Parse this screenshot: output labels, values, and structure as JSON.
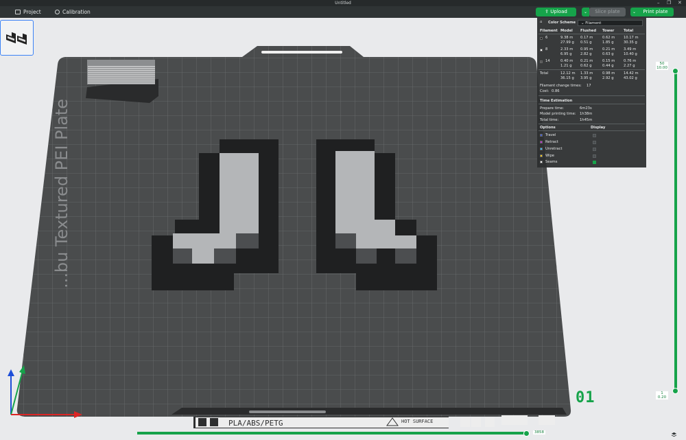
{
  "window": {
    "title": "Untitled"
  },
  "toolbar": {
    "project_label": "Project",
    "calibration_label": "Calibration",
    "upload_label": "Upload",
    "slice_label": "Slice plate",
    "print_label": "Print plate"
  },
  "plate": {
    "bed_text": "...bu Textured PEI Plate",
    "bottom_strip_text": "PLA/ABS/PETG",
    "hot_surface_text": "HOT SURFACE",
    "plate_number": "01"
  },
  "stats_panel": {
    "color_scheme_label": "Color Scheme",
    "color_scheme_value": "Filament",
    "headers": [
      "Filament",
      "Model",
      "Flushed",
      "Tower",
      "Total"
    ],
    "filaments": [
      {
        "id": "6",
        "swatch": "#222222",
        "model": [
          "9.38 m",
          "27.99 g"
        ],
        "flushed": [
          "0.17 m",
          "0.51 g"
        ],
        "tower": [
          "0.62 m",
          "1.85 g"
        ],
        "total": [
          "10.17 m",
          "30.35 g"
        ]
      },
      {
        "id": "8",
        "swatch": "#ffffff",
        "model": [
          "2.33 m",
          "6.95 g"
        ],
        "flushed": [
          "0.95 m",
          "2.82 g"
        ],
        "tower": [
          "0.21 m",
          "0.63 g"
        ],
        "total": [
          "3.49 m",
          "10.40 g"
        ]
      },
      {
        "id": "14",
        "swatch": "#555555",
        "model": [
          "0.40 m",
          "1.21 g"
        ],
        "flushed": [
          "0.21 m",
          "0.62 g"
        ],
        "tower": [
          "0.15 m",
          "0.44 g"
        ],
        "total": [
          "0.76 m",
          "2.27 g"
        ]
      }
    ],
    "total_row": {
      "label": "Total",
      "model": [
        "12.12 m",
        "36.15 g"
      ],
      "flushed": [
        "1.33 m",
        "3.95 g"
      ],
      "tower": [
        "0.98 m",
        "2.92 g"
      ],
      "total": [
        "14.42 m",
        "43.02 g"
      ]
    },
    "filament_change_label": "Filament change times:",
    "filament_change_value": "17",
    "cost_label": "Cost:",
    "cost_value": "0.86",
    "time_section": "Time Estimation",
    "prepare_label": "Prepare time:",
    "prepare_value": "6m23s",
    "model_time_label": "Model printing time:",
    "model_time_value": "1h38m",
    "total_time_label": "Total time:",
    "total_time_value": "1h45m",
    "options_header": "Options",
    "display_header": "Display",
    "options": [
      {
        "label": "Travel",
        "color": "#3b5bdb",
        "checked": false
      },
      {
        "label": "Retract",
        "color": "#c026d3",
        "checked": false
      },
      {
        "label": "Unretract",
        "color": "#38bdf8",
        "checked": false
      },
      {
        "label": "Wipe",
        "color": "#facc15",
        "checked": false
      },
      {
        "label": "Seams",
        "color": "#f5f5f5",
        "checked": true
      }
    ]
  },
  "layer_slider": {
    "top_layer": "50",
    "top_height": "10.00",
    "bottom_layer": "1",
    "bottom_height": "0.20"
  },
  "move_slider": {
    "value": "3858"
  },
  "colors": {
    "accent": "#16a34a",
    "bed": "#4a4c4d",
    "grid": "#6b6e70"
  }
}
